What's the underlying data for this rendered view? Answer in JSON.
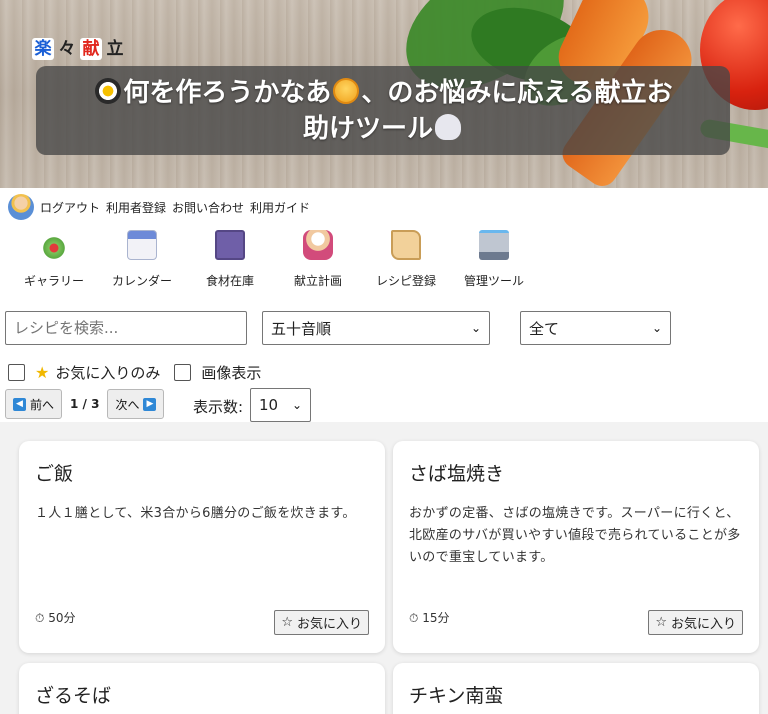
{
  "brand": [
    "楽",
    "々",
    "献",
    "立"
  ],
  "hero": {
    "line1_prefix": "何を作ろうかなあ",
    "line1_suffix": "、のお悩みに応える献立お",
    "line2": "助けツール"
  },
  "toplinks": [
    "ログアウト",
    "利用者登録",
    "お問い合わせ",
    "利用ガイド"
  ],
  "nav": [
    {
      "label": "ギャラリー",
      "icon": "salad-icon"
    },
    {
      "label": "カレンダー",
      "icon": "calendar-icon"
    },
    {
      "label": "食材在庫",
      "icon": "cabinet-icon"
    },
    {
      "label": "献立計画",
      "icon": "chef-icon"
    },
    {
      "label": "レシピ登録",
      "icon": "scroll-icon"
    },
    {
      "label": "管理ツール",
      "icon": "laptop-icon"
    }
  ],
  "filters": {
    "search_placeholder": "レシピを検索...",
    "sort_selected": "五十音順",
    "category_selected": "全て",
    "favorites_only_label": "お気に入りのみ",
    "image_display_label": "画像表示"
  },
  "pager": {
    "prev_label": "前へ",
    "next_label": "次へ",
    "page_indicator": "1 / 3",
    "per_page_label": "表示数:",
    "per_page_value": "10"
  },
  "recipes": [
    {
      "title": "ご飯",
      "description": "１人１膳として、米3合から6膳分のご飯を炊きます。",
      "time": "50分",
      "fav_label": "お気に入り"
    },
    {
      "title": "さば塩焼き",
      "description": "おかずの定番、さばの塩焼きです。スーパーに行くと、北欧産のサバが買いやすい値段で売られていることが多いので重宝しています。",
      "time": "15分",
      "fav_label": "お気に入り"
    },
    {
      "title": "ざるそば"
    },
    {
      "title": "チキン南蛮"
    }
  ]
}
